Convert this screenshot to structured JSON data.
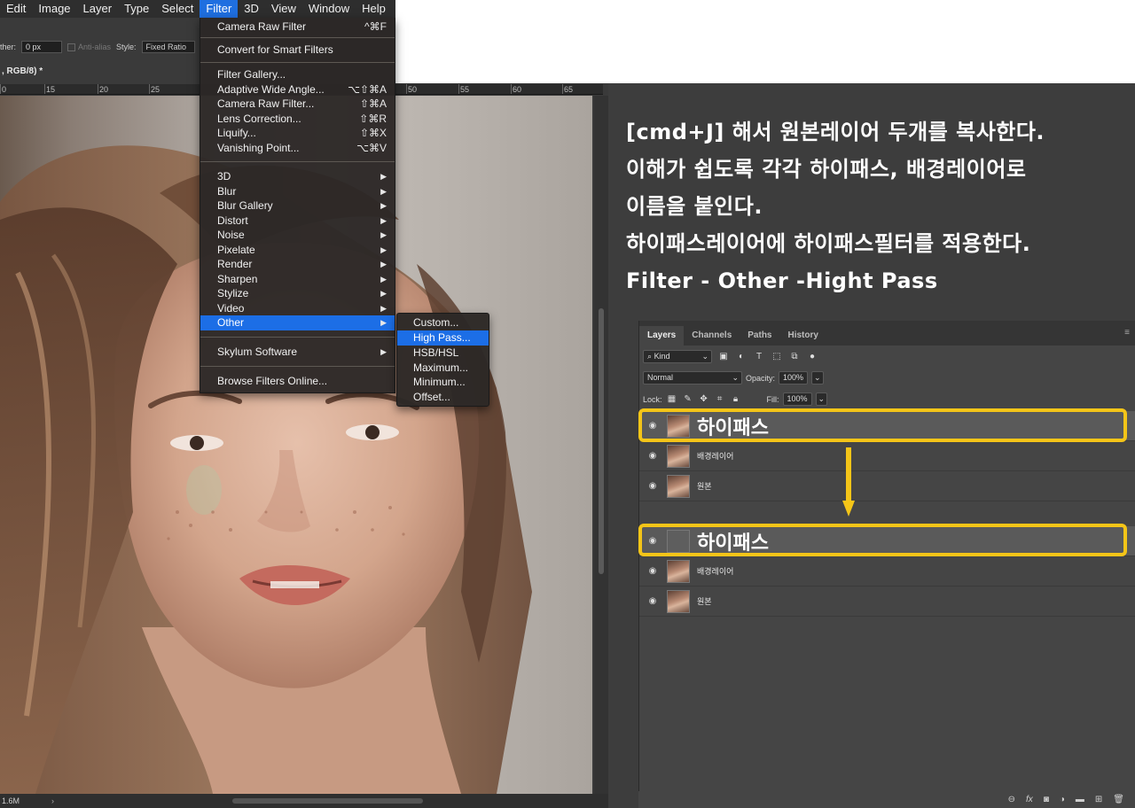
{
  "menubar": {
    "items": [
      "Edit",
      "Image",
      "Layer",
      "Type",
      "Select",
      "Filter",
      "3D",
      "View",
      "Window",
      "Help"
    ],
    "active": "Filter"
  },
  "options": {
    "feather_label": "ther:",
    "feather_value": "0 px",
    "antialias_label": "Anti-alias",
    "style_label": "Style:",
    "style_value": "Fixed Ratio"
  },
  "document": {
    "tab_title": ", RGB/8) *",
    "ruler_ticks": [
      "0",
      "15",
      "20",
      "25",
      "50",
      "55",
      "60",
      "65"
    ],
    "status_text": "1.6M",
    "status_arrow": "›"
  },
  "filter_menu": {
    "top_items": [
      {
        "label": "Camera Raw Filter",
        "shortcut": "^⌘F"
      },
      {
        "label": "Convert for Smart Filters",
        "shortcut": ""
      }
    ],
    "filter_items": [
      {
        "label": "Filter Gallery...",
        "shortcut": ""
      },
      {
        "label": "Adaptive Wide Angle...",
        "shortcut": "⌥⇧⌘A"
      },
      {
        "label": "Camera Raw Filter...",
        "shortcut": "⇧⌘A"
      },
      {
        "label": "Lens Correction...",
        "shortcut": "⇧⌘R"
      },
      {
        "label": "Liquify...",
        "shortcut": "⇧⌘X"
      },
      {
        "label": "Vanishing Point...",
        "shortcut": "⌥⌘V"
      }
    ],
    "sub_items": [
      "3D",
      "Blur",
      "Blur Gallery",
      "Distort",
      "Noise",
      "Pixelate",
      "Render",
      "Sharpen",
      "Stylize",
      "Video",
      "Other"
    ],
    "highlighted": "Other",
    "plugin_items": [
      "Skylum Software"
    ],
    "online_item": "Browse Filters Online..."
  },
  "other_submenu": {
    "items": [
      "Custom...",
      "High Pass...",
      "HSB/HSL",
      "Maximum...",
      "Minimum...",
      "Offset..."
    ],
    "highlighted": "High Pass..."
  },
  "instructions": {
    "lines": [
      "[cmd+J] 해서 원본레이어 두개를 복사한다.",
      "이해가 쉽도록 각각 하이패스, 배경레이어로",
      "이름을 붙인다.",
      "하이패스레이어에 하이패스필터를 적용한다.",
      "Filter - Other -Hight Pass"
    ]
  },
  "layers_panel": {
    "tabs": [
      "Layers",
      "Channels",
      "Paths",
      "History"
    ],
    "active_tab": "Layers",
    "kind_label": "Kind",
    "blend_mode": "Normal",
    "opacity_label": "Opacity:",
    "opacity_value": "100%",
    "lock_label": "Lock:",
    "fill_label": "Fill:",
    "fill_value": "100%",
    "stack_before": [
      {
        "name": "하이패스",
        "selected": true
      },
      {
        "name": "배경레이어",
        "selected": false
      },
      {
        "name": "원본",
        "selected": false
      }
    ],
    "stack_after": [
      {
        "name": "하이패스",
        "selected": true
      },
      {
        "name": "배경레이어",
        "selected": false
      },
      {
        "name": "원본",
        "selected": false
      }
    ],
    "bottom_icons": [
      "link-icon",
      "fx-icon",
      "mask-icon",
      "adjustment-icon",
      "folder-icon",
      "new-layer-icon",
      "trash-icon"
    ],
    "highlight_color": "#f5c518"
  }
}
